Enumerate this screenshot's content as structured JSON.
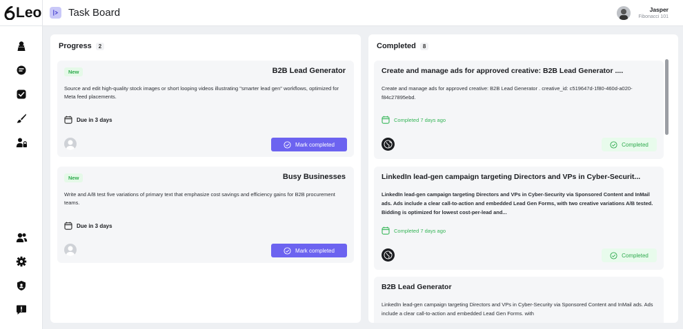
{
  "app": {
    "logo_text": "Leo",
    "page_title": "Task Board"
  },
  "user": {
    "name": "Jasper",
    "subtitle": "Fibonacci 101"
  },
  "sidebar": {
    "items": [
      {
        "icon": "agent-icon"
      },
      {
        "icon": "chat-icon"
      },
      {
        "icon": "task-check-icon"
      },
      {
        "icon": "brush-icon"
      },
      {
        "icon": "user-lock-icon"
      },
      {
        "icon": "team-icon"
      },
      {
        "icon": "settings-icon"
      },
      {
        "icon": "shield-icon"
      },
      {
        "icon": "feedback-icon"
      }
    ]
  },
  "progress": {
    "title": "Progress",
    "count": "2",
    "cards": [
      {
        "tag": "New",
        "title": "B2B Lead Generator",
        "description": "Source and edit high-quality stock images or short looping videos illustrating \"smarter lead gen\" workflows, optimized for Meta feed placements.",
        "due": "Due in 3 days",
        "action": "Mark completed"
      },
      {
        "tag": "New",
        "title": "Busy Businesses",
        "description": "Write and A/B test five variations of primary text that emphasize cost savings and efficiency gains for B2B procurement teams.",
        "due": "Due in 3 days",
        "action": "Mark completed"
      }
    ]
  },
  "completed": {
    "title": "Completed",
    "count": "8",
    "cards": [
      {
        "title": "Create and manage ads for approved creative: B2B Lead Generator ....",
        "description": "Create and manage ads for approved creative: B2B Lead Generator . creative_id: c519647d-1f80-460d-a020-f84c27895ebd.",
        "completed_ago": "Completed 7 days ago",
        "status": "Completed"
      },
      {
        "title": "LinkedIn lead-gen campaign targeting Directors and VPs in Cyber-Securit...",
        "description": "LinkedIn lead-gen campaign targeting Directors and VPs in Cyber-Security via Sponsored Content and InMail ads. Ads include a clear call-to-action and embedded Lead Gen Forms, with two creative variations A/B tested. Bidding is optimized for lowest cost-per-lead and...",
        "completed_ago": "Completed 7 days ago",
        "status": "Completed"
      },
      {
        "title": "B2B Lead Generator",
        "description": "LinkedIn lead-gen campaign targeting Directors and VPs in Cyber-Security via Sponsored Content and InMail ads. Ads include a clear call-to-action and embedded Lead Gen Forms. with"
      }
    ]
  },
  "colors": {
    "accent": "#6c63f0",
    "success": "#2eaa4d",
    "new_tag_bg": "#e5f9e8"
  }
}
